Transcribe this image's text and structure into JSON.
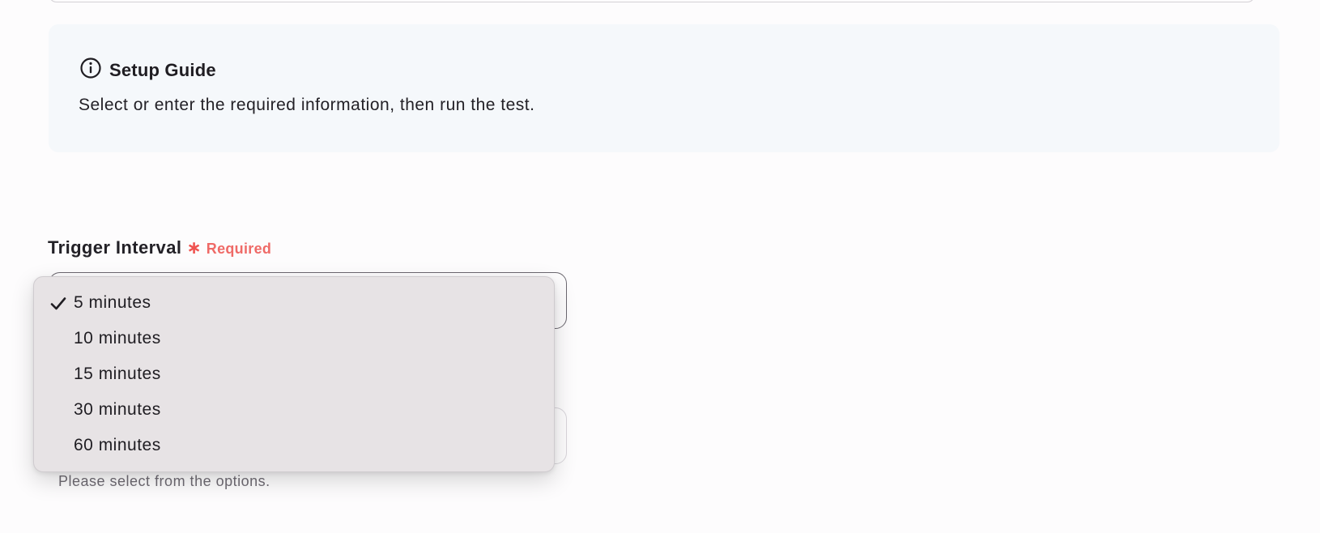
{
  "setup_guide": {
    "title": "Setup Guide",
    "description": "Select or enter the required information, then run the test."
  },
  "trigger_interval": {
    "label": "Trigger Interval",
    "required_marker": "∗",
    "required_text": "Required",
    "helper_text": "Please select from the options.",
    "selected": "5 minutes",
    "options": [
      {
        "label": "5 minutes",
        "selected": true
      },
      {
        "label": "10 minutes",
        "selected": false
      },
      {
        "label": "15 minutes",
        "selected": false
      },
      {
        "label": "30 minutes",
        "selected": false
      },
      {
        "label": "60 minutes",
        "selected": false
      }
    ]
  },
  "colors": {
    "guide_background": "#f5f8fb",
    "required": "#ef5350",
    "dropdown_background": "#e7e3e5"
  }
}
